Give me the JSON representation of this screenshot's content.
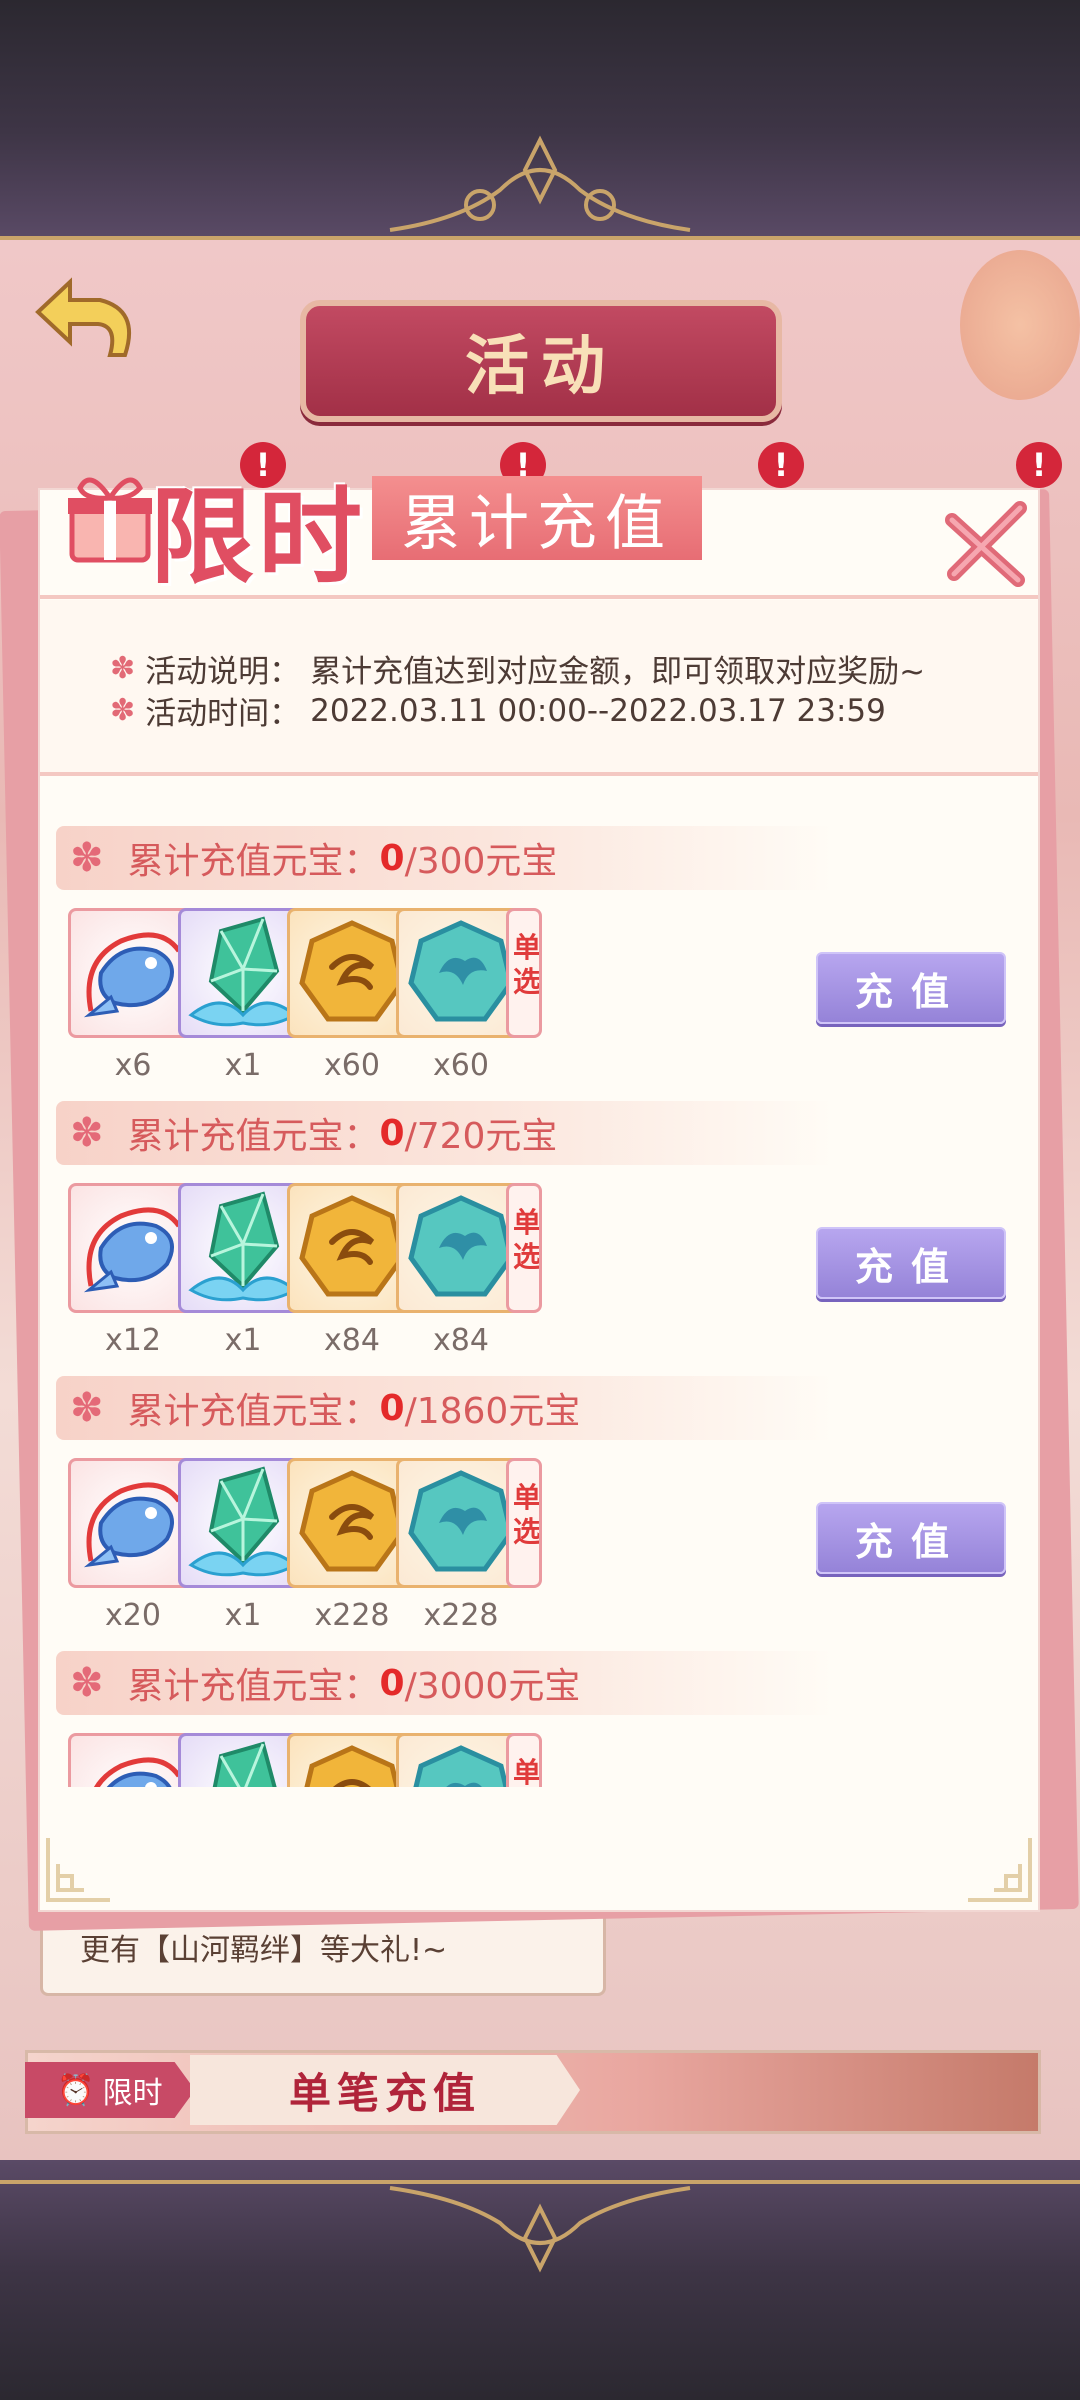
{
  "header": {
    "title": "活动",
    "alert_mark": "!"
  },
  "modal": {
    "title_big": "限时",
    "title_small": "累计充值",
    "desc_label": "活动说明：",
    "desc_text": "累计充值达到对应金额，即可领取对应奖励~",
    "time_label": "活动时间：",
    "time_text": "2022.03.11 00:00--2022.03.17 23:59"
  },
  "tiers": [
    {
      "label": "累计充值元宝：",
      "current": "0",
      "goal": "/300元宝",
      "qty": [
        "x6",
        "x1",
        "x60",
        "x60"
      ],
      "button": "充值"
    },
    {
      "label": "累计充值元宝：",
      "current": "0",
      "goal": "/720元宝",
      "qty": [
        "x12",
        "x1",
        "x84",
        "x84"
      ],
      "button": "充值"
    },
    {
      "label": "累计充值元宝：",
      "current": "0",
      "goal": "/1860元宝",
      "qty": [
        "x20",
        "x1",
        "x228",
        "x228"
      ],
      "button": "充值"
    },
    {
      "label": "累计充值元宝：",
      "current": "0",
      "goal": "/3000元宝",
      "qty": [],
      "button": ""
    }
  ],
  "choice_item_text": "单选",
  "background": {
    "note_text": "更有【山河羁绊】等大礼!~",
    "tag_text": "限时",
    "banner_title": "单笔充值"
  },
  "icons": {
    "back": "back-arrow-icon",
    "close": "close-icon",
    "gift": "gift-icon",
    "fish": "koi-fish-icon",
    "crystal": "green-crystal-icon",
    "gold": "gold-token-icon",
    "jade": "jade-token-icon",
    "flower": "flower-icon",
    "clock": "clock-icon"
  },
  "colors": {
    "accent": "#e04e62",
    "button": "#a594e0",
    "highlight": "#e42a2a"
  }
}
